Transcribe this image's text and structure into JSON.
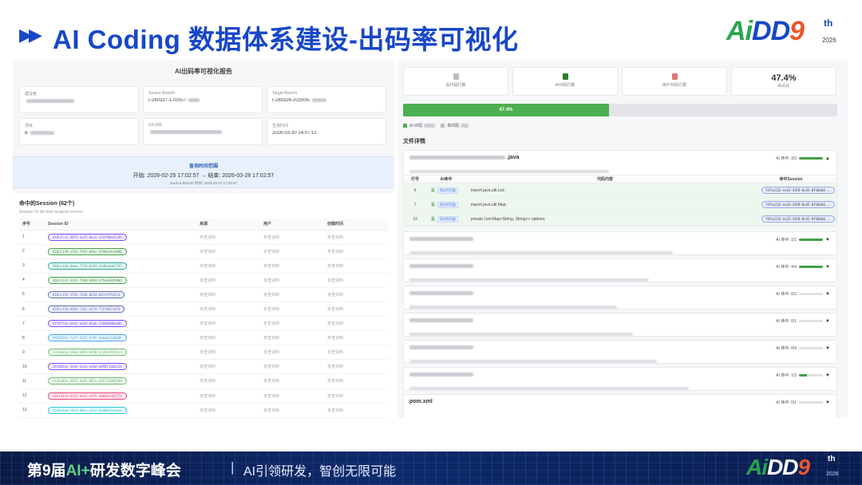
{
  "slide": {
    "title": "AI Coding 数据体系建设-出码率可视化",
    "logo": {
      "letters": [
        "A",
        "i",
        "D",
        "D",
        "9"
      ],
      "sup": "th",
      "year": "2026"
    }
  },
  "report": {
    "title": "AI出码率可视化报告",
    "info": [
      {
        "label": "建设者",
        "value": ""
      },
      {
        "label": "Source Branch",
        "value": "r-260327-170257-"
      },
      {
        "label": "Target Branch",
        "value": "r-260326-202505-"
      },
      {
        "label": "项目",
        "value": "d."
      },
      {
        "label": "Git URL",
        "value": ""
      },
      {
        "label": "生成时间",
        "value": "2026-03-30 14:07:12"
      }
    ],
    "range": {
      "title": "查询时间范围",
      "text": "开始: 2026-02-25 17:02:57 → 结束: 2026-03-28 17:02:57",
      "sub": "Source Branch 时间: 2026-03-27 17:02:57"
    },
    "sessions": {
      "title": "命中的Session (62个)",
      "subtitle": "Session ID list from analysis service",
      "columns": [
        "序号",
        "Session ID",
        "来源",
        "用户",
        "创建时间"
      ],
      "placeholder": "未查询到",
      "rows": [
        {
          "index": "1",
          "id": "018cfcc1-4072-4c67-8aca-c54f98ba5c96",
          "color": "#7c4dff"
        },
        {
          "index": "2",
          "id": "018cc139-a7b2-7492-b0bc-4f90dc4c8d00",
          "color": "#43a047"
        },
        {
          "index": "3",
          "id": "018cc128-da6e-7750-b193-35d63ea07797",
          "color": "#26a69a"
        },
        {
          "index": "4",
          "id": "018cc131-4c67-7200-a803-ef5ae62d5d0d",
          "color": "#43a047"
        },
        {
          "index": "5",
          "id": "018cc132-57d2-7a50-8d14-0d7c9f5421d",
          "color": "#5c6bc0"
        },
        {
          "index": "6",
          "id": "018cc133-0203-7162-a274-721f0621070",
          "color": "#5c6bc0"
        },
        {
          "index": "7",
          "id": "0f59774e-6e4c-4e92-81bb-21840908da0e",
          "color": "#7c4dff"
        },
        {
          "index": "8",
          "id": "0f620201-fa75-4587-b7d5-6dea01340a0b",
          "color": "#42a5f5"
        },
        {
          "index": "9",
          "id": "131ade4a-16e6-4d92-9d50-cc20337492ca",
          "color": "#66bb6a"
        },
        {
          "index": "10",
          "id": "1439b5dc-3e9e-4a3a-a40d-e09071db8c2a",
          "color": "#7c4dff"
        },
        {
          "index": "11",
          "id": "143ba89c-0675-4e07-887e-b01713889790",
          "color": "#66bb6a"
        },
        {
          "index": "12",
          "id": "18e7d37d-0147-4e31-a955-a00681a0757d",
          "color": "#ec407a"
        },
        {
          "index": "13",
          "id": "1558c4a4-19c3-48cc-a317-644047baaa13",
          "color": "#26c6da"
        }
      ]
    }
  },
  "stats": {
    "cards": [
      {
        "label": "总代码行数",
        "icon_color": "#bdbdbd"
      },
      {
        "label": "AI代码行数",
        "icon_color": "#2e7d32"
      },
      {
        "label": "用户代码行数",
        "icon_color": "#e57373"
      }
    ],
    "ai_ratio": {
      "value": "47.4%",
      "label": "AI占比",
      "fraction": 0.474
    },
    "legend": {
      "ai": "AI 匹配",
      "unmatched": "未匹配"
    },
    "files_title": "文件详情"
  },
  "files": [
    {
      "name": ".java",
      "hit_label": "AI 命中: 3/3",
      "fraction": 1.0,
      "expanded": true,
      "columns": [
        "行号",
        "AI命中",
        "代码内容",
        "命中Session"
      ],
      "rows": [
        {
          "line": "6",
          "check": "是",
          "tag": "同文件匹配",
          "code": "import java.util.List;",
          "session": "f3fac232-ee23-43f0-8c45-0f18dd4..."
        },
        {
          "line": "7",
          "check": "是",
          "tag": "同文件匹配",
          "code": "import java.util.Map;",
          "session": "f3fac232-ee23-43f0-8c45-0f18dd4..."
        },
        {
          "line": "19",
          "check": "是",
          "tag": "同文件匹配",
          "code": "private List<Map<String, String>> options;",
          "session": "f3fac232-ee23-43f0-8c45-0f18dd4..."
        }
      ]
    },
    {
      "name": "",
      "hit_label": "AI 命中: 1/1",
      "fraction": 1.0
    },
    {
      "name": "",
      "hit_label": "AI 命中: 4/4",
      "fraction": 1.0
    },
    {
      "name": "",
      "hit_label": "AI 命中: 0/2",
      "fraction": 0.0
    },
    {
      "name": "",
      "hit_label": "AI 命中: 0/1",
      "fraction": 0.0
    },
    {
      "name": "",
      "hit_label": "AI 命中: 0/4",
      "fraction": 0.0
    },
    {
      "name": "",
      "hit_label": "AI 命中: 1/3",
      "fraction": 0.33
    },
    {
      "name": "pom.xml",
      "hit_label": "AI 命中: 0/1",
      "fraction": 0.0
    }
  ],
  "footer": {
    "event_pre": "第9届",
    "event_accent": "AI+",
    "event_post": "研发数字峰会",
    "separator": "|",
    "slogan": "AI引领研发，智创无限可能"
  }
}
